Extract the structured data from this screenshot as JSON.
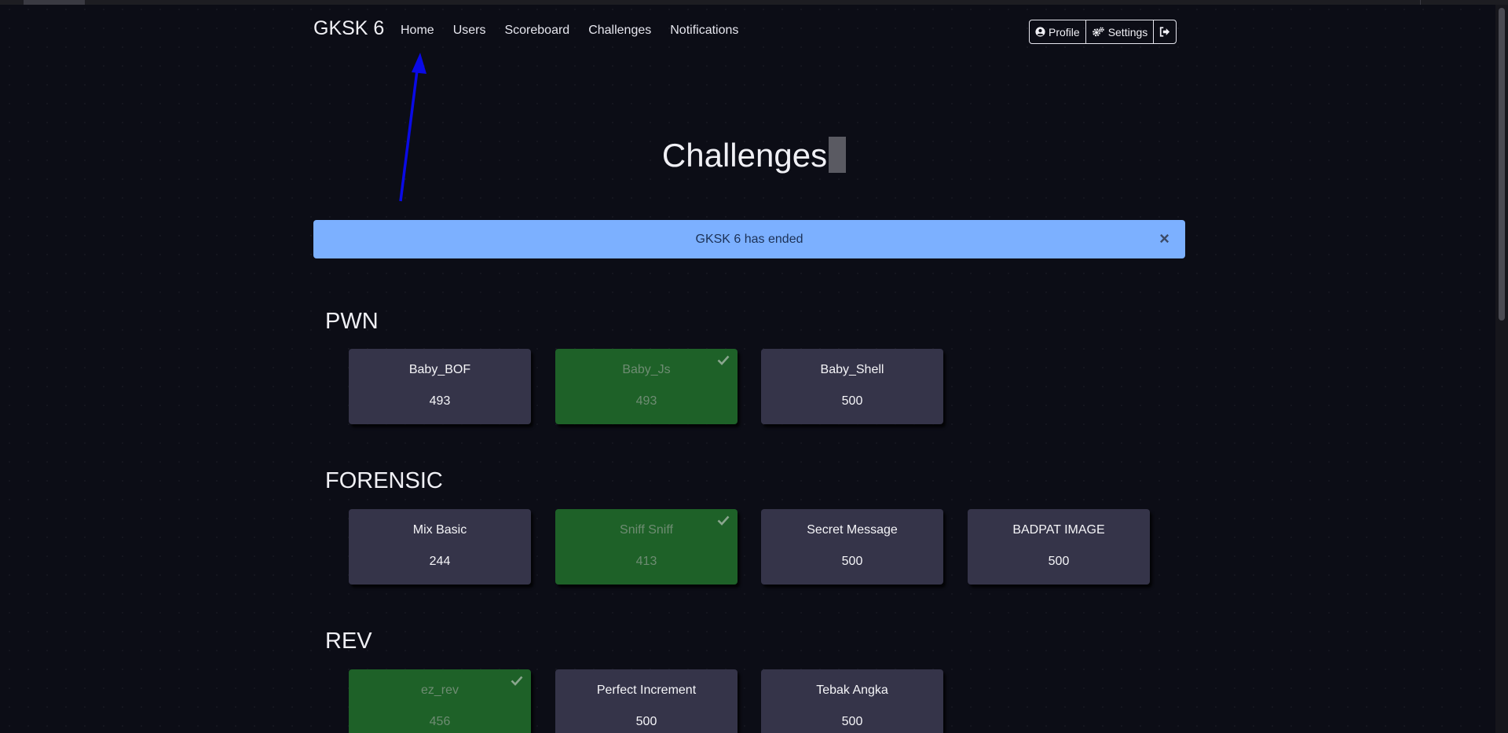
{
  "navbar": {
    "brand": "GKSK 6",
    "links": [
      "Home",
      "Users",
      "Scoreboard",
      "Challenges",
      "Notifications"
    ],
    "buttons": {
      "profile": "Profile",
      "settings": "Settings"
    }
  },
  "page": {
    "title": "Challenges"
  },
  "alert": {
    "message": "GKSK 6 has ended",
    "close": "×"
  },
  "categories": [
    {
      "name": "PWN",
      "challenges": [
        {
          "name": "Baby_BOF",
          "points": "493",
          "solved": false
        },
        {
          "name": "Baby_Js",
          "points": "493",
          "solved": true
        },
        {
          "name": "Baby_Shell",
          "points": "500",
          "solved": false
        }
      ]
    },
    {
      "name": "FORENSIC",
      "challenges": [
        {
          "name": "Mix Basic",
          "points": "244",
          "solved": false
        },
        {
          "name": "Sniff Sniff",
          "points": "413",
          "solved": true
        },
        {
          "name": "Secret Message",
          "points": "500",
          "solved": false
        },
        {
          "name": "BADPAT IMAGE",
          "points": "500",
          "solved": false
        }
      ]
    },
    {
      "name": "REV",
      "challenges": [
        {
          "name": "ez_rev",
          "points": "456",
          "solved": true
        },
        {
          "name": "Perfect Increment",
          "points": "500",
          "solved": false
        },
        {
          "name": "Tebak Angka",
          "points": "500",
          "solved": false
        }
      ]
    }
  ],
  "colors": {
    "background": "#0c0d16",
    "card": "#353449",
    "card_solved": "#1e6128",
    "alert": "#7cb0ff",
    "annotation_arrow": "#0a0ae6"
  },
  "icons": [
    "user-circle-icon",
    "gears-icon",
    "sign-out-icon",
    "check-icon",
    "close-icon"
  ]
}
